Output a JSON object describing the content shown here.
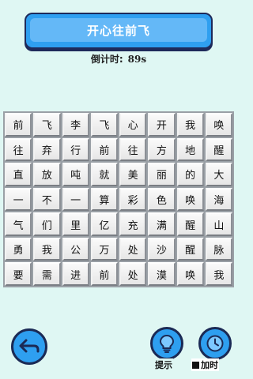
{
  "title": "开心往前飞",
  "timer": {
    "label": "倒计时:",
    "value": "89s"
  },
  "grid": [
    [
      "前",
      "飞",
      "李",
      "飞",
      "心",
      "开",
      "我",
      "唤"
    ],
    [
      "往",
      "弃",
      "行",
      "前",
      "往",
      "方",
      "地",
      "醒"
    ],
    [
      "直",
      "放",
      "吨",
      "就",
      "美",
      "丽",
      "的",
      "大"
    ],
    [
      "一",
      "不",
      "一",
      "算",
      "彩",
      "色",
      "唤",
      "海"
    ],
    [
      "气",
      "们",
      "里",
      "亿",
      "充",
      "满",
      "醒",
      "山"
    ],
    [
      "勇",
      "我",
      "公",
      "万",
      "处",
      "沙",
      "醒",
      "脉"
    ],
    [
      "要",
      "需",
      "进",
      "前",
      "处",
      "漠",
      "唤",
      "我"
    ]
  ],
  "buttons": {
    "back": {
      "icon": "back-arrow-icon"
    },
    "hint": {
      "label": "提示",
      "icon": "lightbulb-icon"
    },
    "time": {
      "label": "加时",
      "icon": "clock-icon"
    }
  },
  "colors": {
    "background": "#dff7f3",
    "accent": "#2f9ff0",
    "outline": "#1e2a5a"
  }
}
